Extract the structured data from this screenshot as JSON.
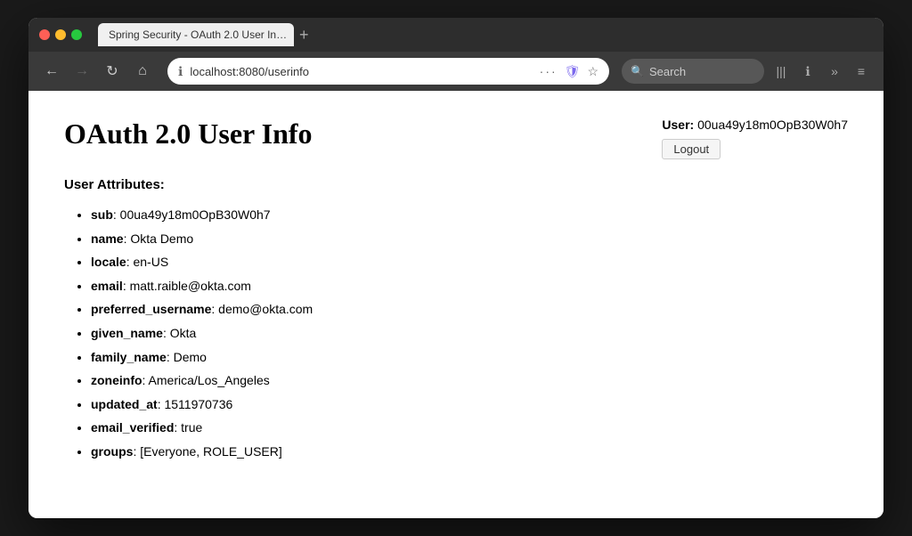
{
  "window": {
    "title": "Spring Security - OAuth 2.0 User In…"
  },
  "titlebar": {
    "traffic_close": "●",
    "traffic_minimize": "●",
    "traffic_maximize": "●",
    "tab_label": "Spring Security - OAuth 2.0 User In…",
    "new_tab_symbol": "+"
  },
  "navbar": {
    "back_label": "←",
    "forward_label": "→",
    "reload_label": "↻",
    "home_label": "⌂",
    "address": "localhost:8080/userinfo",
    "dots_label": "···",
    "shield_label": "🛡",
    "star_label": "☆",
    "search_placeholder": "Search",
    "library_icon": "|||",
    "info_icon": "ℹ",
    "more_icon": "»",
    "menu_icon": "≡"
  },
  "page": {
    "title": "OAuth 2.0 User Info",
    "user_label": "User:",
    "user_value": "00ua49y18m0OpB30W0h7",
    "logout_label": "Logout",
    "attributes_heading": "User Attributes:",
    "attributes": [
      {
        "key": "sub",
        "value": "00ua49y18m0OpB30W0h7"
      },
      {
        "key": "name",
        "value": "Okta Demo"
      },
      {
        "key": "locale",
        "value": "en-US"
      },
      {
        "key": "email",
        "value": "matt.raible@okta.com"
      },
      {
        "key": "preferred_username",
        "value": "demo@okta.com"
      },
      {
        "key": "given_name",
        "value": "Okta"
      },
      {
        "key": "family_name",
        "value": "Demo"
      },
      {
        "key": "zoneinfo",
        "value": "America/Los_Angeles"
      },
      {
        "key": "updated_at",
        "value": "1511970736"
      },
      {
        "key": "email_verified",
        "value": "true"
      },
      {
        "key": "groups",
        "value": "[Everyone, ROLE_USER]"
      }
    ]
  }
}
